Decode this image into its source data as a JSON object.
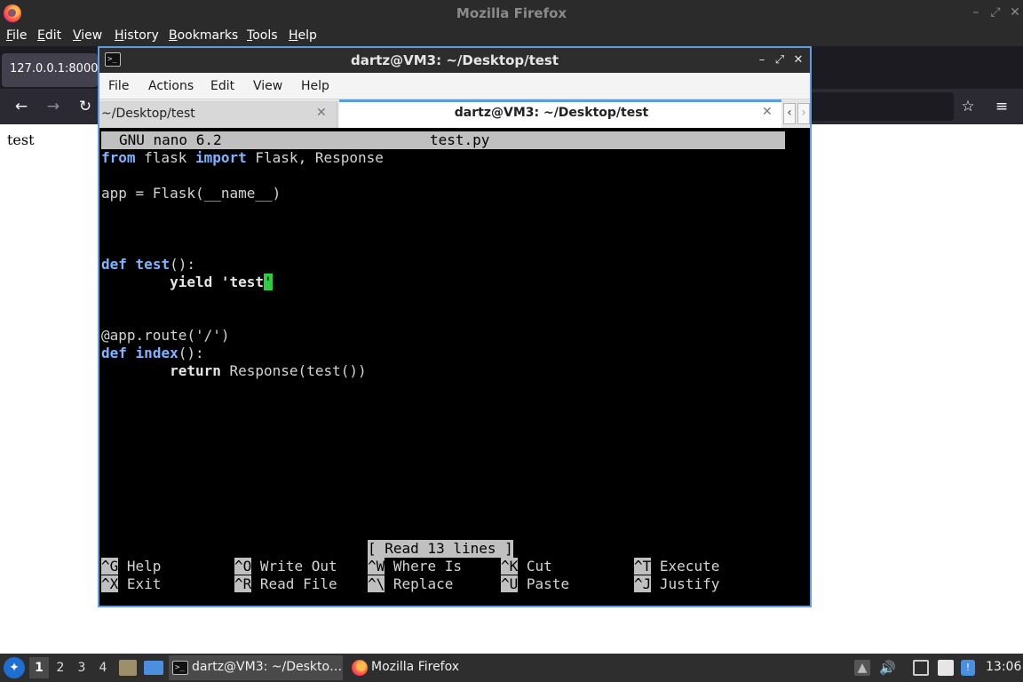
{
  "firefox": {
    "window_title": "Mozilla Firefox",
    "menu": [
      "File",
      "Edit",
      "View",
      "History",
      "Bookmarks",
      "Tools",
      "Help"
    ],
    "tab_title": "127.0.0.1:8000",
    "page_text": "test"
  },
  "terminal": {
    "window_title": "dartz@VM3: ~/Desktop/test",
    "menu": [
      "File",
      "Actions",
      "Edit",
      "View",
      "Help"
    ],
    "tabs": [
      {
        "label": "~/Desktop/test",
        "active": false
      },
      {
        "label": "dartz@VM3: ~/Desktop/test",
        "active": true
      }
    ],
    "nano": {
      "version": "GNU nano 6.2",
      "filename": "test.py",
      "code": {
        "l1": {
          "kw1": "from",
          "mod": " flask ",
          "kw2": "import",
          "rest": " Flask, Response"
        },
        "l3": "app = Flask(__name__)",
        "l6": {
          "kw": "def",
          "name": "test",
          "rest": "():"
        },
        "l7": {
          "indent": "        ",
          "kw": "yield",
          "str": " 'test",
          "cursor_char": "'"
        },
        "l10": "@app.route('/')",
        "l11": {
          "kw": "def",
          "name": "index",
          "rest": "():"
        },
        "l12": {
          "indent": "        ",
          "kw": "return",
          "rest": " Response(test())"
        }
      },
      "status": "[ Read 13 lines ]",
      "shortcuts": [
        {
          "key": "^G",
          "label": "Help"
        },
        {
          "key": "^O",
          "label": "Write Out"
        },
        {
          "key": "^W",
          "label": "Where Is"
        },
        {
          "key": "^K",
          "label": "Cut"
        },
        {
          "key": "^T",
          "label": "Execute"
        },
        {
          "key": "^X",
          "label": "Exit"
        },
        {
          "key": "^R",
          "label": "Read File"
        },
        {
          "key": "^\\",
          "label": "Replace"
        },
        {
          "key": "^U",
          "label": "Paste"
        },
        {
          "key": "^J",
          "label": "Justify"
        }
      ]
    }
  },
  "taskbar": {
    "workspaces": [
      "1",
      "2",
      "3",
      "4"
    ],
    "active_workspace": "1",
    "tasks": [
      {
        "label": "dartz@VM3: ~/Deskto…",
        "icon": "terminal-icon",
        "active": true
      },
      {
        "label": "Mozilla Firefox",
        "icon": "firefox-icon",
        "active": false
      }
    ],
    "clock": "13:06"
  }
}
